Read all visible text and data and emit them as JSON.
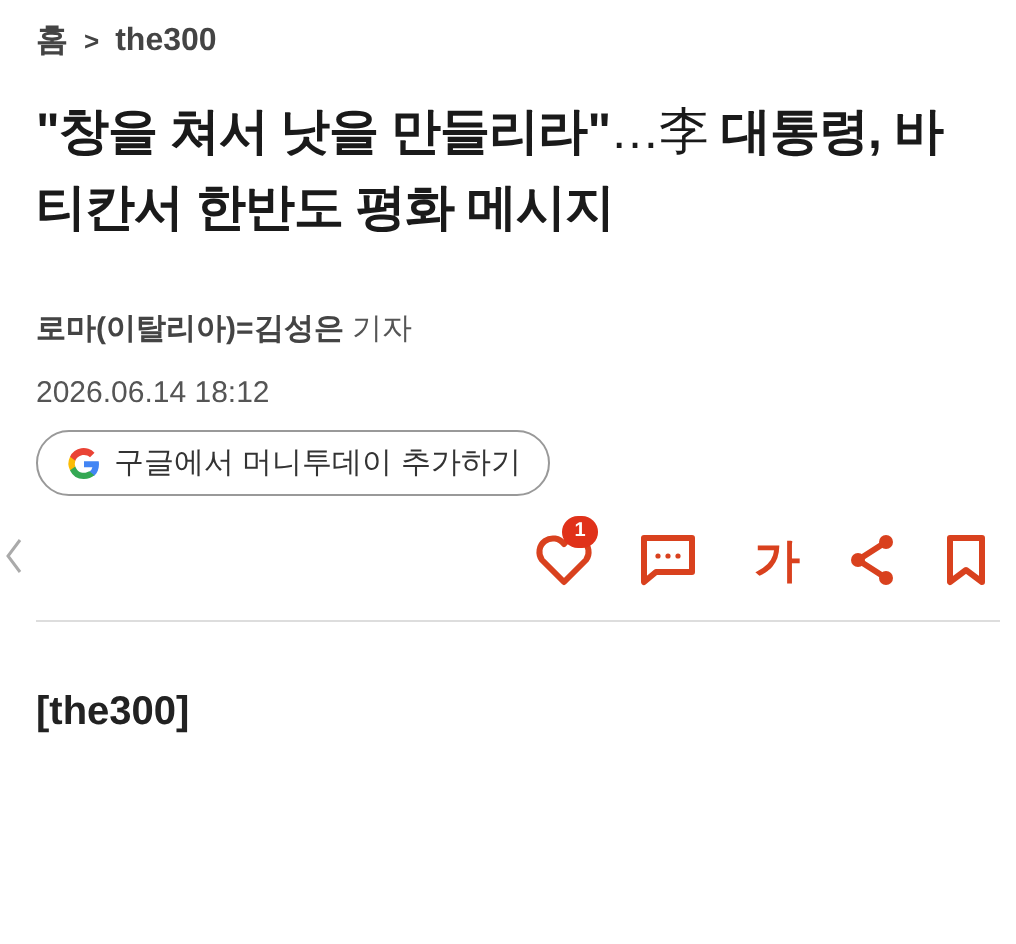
{
  "breadcrumb": {
    "home": "홈",
    "separator": ">",
    "section": "the300"
  },
  "headline": "**\"창을 쳐서 낫을 만들리라\"**…李 **대통령, 바티칸서 한반도 평화 메시지**",
  "byline": "**로마(이탈리아)=김성은** 기자",
  "date": "2026.06.14 18:12",
  "google_button": {
    "label": "구글에서 머니투데이 추가하기"
  },
  "toolbar": {
    "like_count": "1",
    "font_button": "가"
  },
  "body": "[the300]"
}
